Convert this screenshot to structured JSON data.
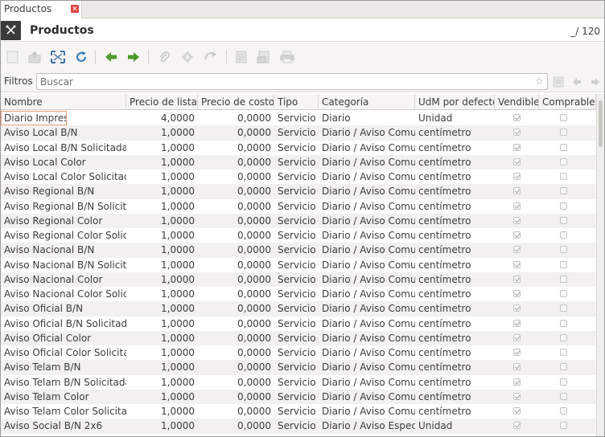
{
  "tab": {
    "label": "Productos",
    "close_glyph": "×"
  },
  "header": {
    "title": "Productos",
    "counter": "_/ 120"
  },
  "toolbar": {
    "icons": [
      "new-icon",
      "save-icon",
      "fullscreen-icon",
      "reload-icon",
      "previous-icon",
      "next-icon",
      "attachment-icon",
      "action-icon",
      "relate-icon",
      "report-icon",
      "email-icon",
      "print-icon"
    ]
  },
  "filter": {
    "label": "Filtros",
    "placeholder": "Buscar"
  },
  "table": {
    "columns": [
      "Nombre",
      "Precio de lista",
      "Precio de costo",
      "Tipo",
      "Categoría",
      "UdM por defecto",
      "Vendible",
      "Comprable"
    ],
    "rows": [
      {
        "nombre": "Diario Impreso",
        "lista": "4,0000",
        "costo": "0,0000",
        "tipo": "Servicio",
        "categoria": "Diario",
        "udm": "Unidad",
        "vendible": true,
        "comprable": false
      },
      {
        "nombre": "Aviso Local B/N",
        "lista": "1,0000",
        "costo": "0,0000",
        "tipo": "Servicio",
        "categoria": "Diario / Aviso Comun",
        "udm": "centímetro",
        "vendible": true,
        "comprable": false
      },
      {
        "nombre": "Aviso Local B/N Solicitada",
        "lista": "1,0000",
        "costo": "0,0000",
        "tipo": "Servicio",
        "categoria": "Diario / Aviso Comun",
        "udm": "centímetro",
        "vendible": true,
        "comprable": false
      },
      {
        "nombre": "Aviso Local Color",
        "lista": "1,0000",
        "costo": "0,0000",
        "tipo": "Servicio",
        "categoria": "Diario / Aviso Comun",
        "udm": "centímetro",
        "vendible": true,
        "comprable": false
      },
      {
        "nombre": "Aviso Local Color Solicitada",
        "lista": "1,0000",
        "costo": "0,0000",
        "tipo": "Servicio",
        "categoria": "Diario / Aviso Comun",
        "udm": "centímetro",
        "vendible": true,
        "comprable": false
      },
      {
        "nombre": "Aviso Regional B/N",
        "lista": "1,0000",
        "costo": "0,0000",
        "tipo": "Servicio",
        "categoria": "Diario / Aviso Comun",
        "udm": "centímetro",
        "vendible": true,
        "comprable": false
      },
      {
        "nombre": "Aviso Regional B/N Solicitada",
        "lista": "1,0000",
        "costo": "0,0000",
        "tipo": "Servicio",
        "categoria": "Diario / Aviso Comun",
        "udm": "centímetro",
        "vendible": true,
        "comprable": false
      },
      {
        "nombre": "Aviso Regional Color",
        "lista": "1,0000",
        "costo": "0,0000",
        "tipo": "Servicio",
        "categoria": "Diario / Aviso Comun",
        "udm": "centímetro",
        "vendible": true,
        "comprable": false
      },
      {
        "nombre": "Aviso Regional Color Solicitada",
        "lista": "1,0000",
        "costo": "0,0000",
        "tipo": "Servicio",
        "categoria": "Diario / Aviso Comun",
        "udm": "centímetro",
        "vendible": true,
        "comprable": false
      },
      {
        "nombre": "Aviso Nacional B/N",
        "lista": "1,0000",
        "costo": "0,0000",
        "tipo": "Servicio",
        "categoria": "Diario / Aviso Comun",
        "udm": "centímetro",
        "vendible": true,
        "comprable": false
      },
      {
        "nombre": "Aviso Nacional B/N Solicitada",
        "lista": "1,0000",
        "costo": "0,0000",
        "tipo": "Servicio",
        "categoria": "Diario / Aviso Comun",
        "udm": "centímetro",
        "vendible": true,
        "comprable": false
      },
      {
        "nombre": "Aviso Nacional Color",
        "lista": "1,0000",
        "costo": "0,0000",
        "tipo": "Servicio",
        "categoria": "Diario / Aviso Comun",
        "udm": "centímetro",
        "vendible": true,
        "comprable": false
      },
      {
        "nombre": "Aviso Nacional Color Solicitada",
        "lista": "1,0000",
        "costo": "0,0000",
        "tipo": "Servicio",
        "categoria": "Diario / Aviso Comun",
        "udm": "centímetro",
        "vendible": true,
        "comprable": false
      },
      {
        "nombre": "Aviso Oficial B/N",
        "lista": "1,0000",
        "costo": "0,0000",
        "tipo": "Servicio",
        "categoria": "Diario / Aviso Comun",
        "udm": "centímetro",
        "vendible": true,
        "comprable": false
      },
      {
        "nombre": "Aviso Oficial B/N Solicitada",
        "lista": "1,0000",
        "costo": "0,0000",
        "tipo": "Servicio",
        "categoria": "Diario / Aviso Comun",
        "udm": "centímetro",
        "vendible": true,
        "comprable": false
      },
      {
        "nombre": "Aviso Oficial Color",
        "lista": "1,0000",
        "costo": "0,0000",
        "tipo": "Servicio",
        "categoria": "Diario / Aviso Comun",
        "udm": "centímetro",
        "vendible": true,
        "comprable": false
      },
      {
        "nombre": "Aviso Oficial Color Solicitada",
        "lista": "1,0000",
        "costo": "0,0000",
        "tipo": "Servicio",
        "categoria": "Diario / Aviso Comun",
        "udm": "centímetro",
        "vendible": true,
        "comprable": false
      },
      {
        "nombre": "Aviso Telam B/N",
        "lista": "1,0000",
        "costo": "0,0000",
        "tipo": "Servicio",
        "categoria": "Diario / Aviso Comun",
        "udm": "centímetro",
        "vendible": true,
        "comprable": false
      },
      {
        "nombre": "Aviso Telam B/N Solicitada",
        "lista": "1,0000",
        "costo": "0,0000",
        "tipo": "Servicio",
        "categoria": "Diario / Aviso Comun",
        "udm": "centímetro",
        "vendible": true,
        "comprable": false
      },
      {
        "nombre": "Aviso Telam Color",
        "lista": "1,0000",
        "costo": "0,0000",
        "tipo": "Servicio",
        "categoria": "Diario / Aviso Comun",
        "udm": "centímetro",
        "vendible": true,
        "comprable": false
      },
      {
        "nombre": "Aviso Telam Color Solicitada",
        "lista": "1,0000",
        "costo": "0,0000",
        "tipo": "Servicio",
        "categoria": "Diario / Aviso Comun",
        "udm": "centímetro",
        "vendible": true,
        "comprable": false
      },
      {
        "nombre": "Aviso Social B/N 2x6",
        "lista": "1,0000",
        "costo": "0,0000",
        "tipo": "Servicio",
        "categoria": "Diario / Aviso Especial",
        "udm": "Unidad",
        "vendible": true,
        "comprable": false
      }
    ]
  },
  "colors": {
    "accent_selected": "#e7a07a",
    "close_red": "#e04848",
    "arrow_green": "#4c9a2a",
    "reload_blue": "#3a7fc4"
  }
}
